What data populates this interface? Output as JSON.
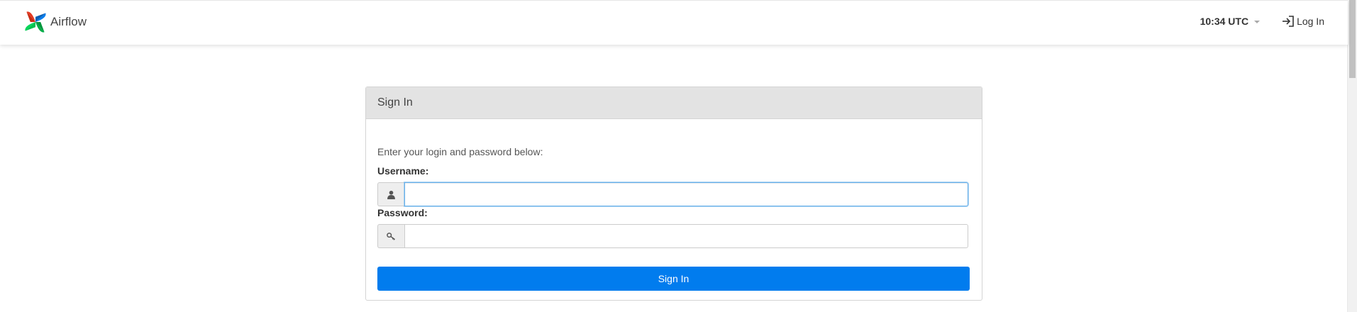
{
  "navbar": {
    "brand_name": "Airflow",
    "clock": "10:34 UTC",
    "login_label": "Log In"
  },
  "signin_panel": {
    "title": "Sign In",
    "instruction": "Enter your login and password below:",
    "username_label": "Username:",
    "username_value": "",
    "password_label": "Password:",
    "password_value": "",
    "submit_label": "Sign In"
  },
  "colors": {
    "primary_button": "#017cee",
    "panel_heading_bg": "#e3e3e3",
    "focus_border": "#66afe9"
  },
  "icons": {
    "brand": "airflow-pinwheel-logo",
    "login": "sign-in-icon",
    "username": "user-icon",
    "password": "key-icon",
    "clock_dropdown": "caret-down-icon"
  }
}
